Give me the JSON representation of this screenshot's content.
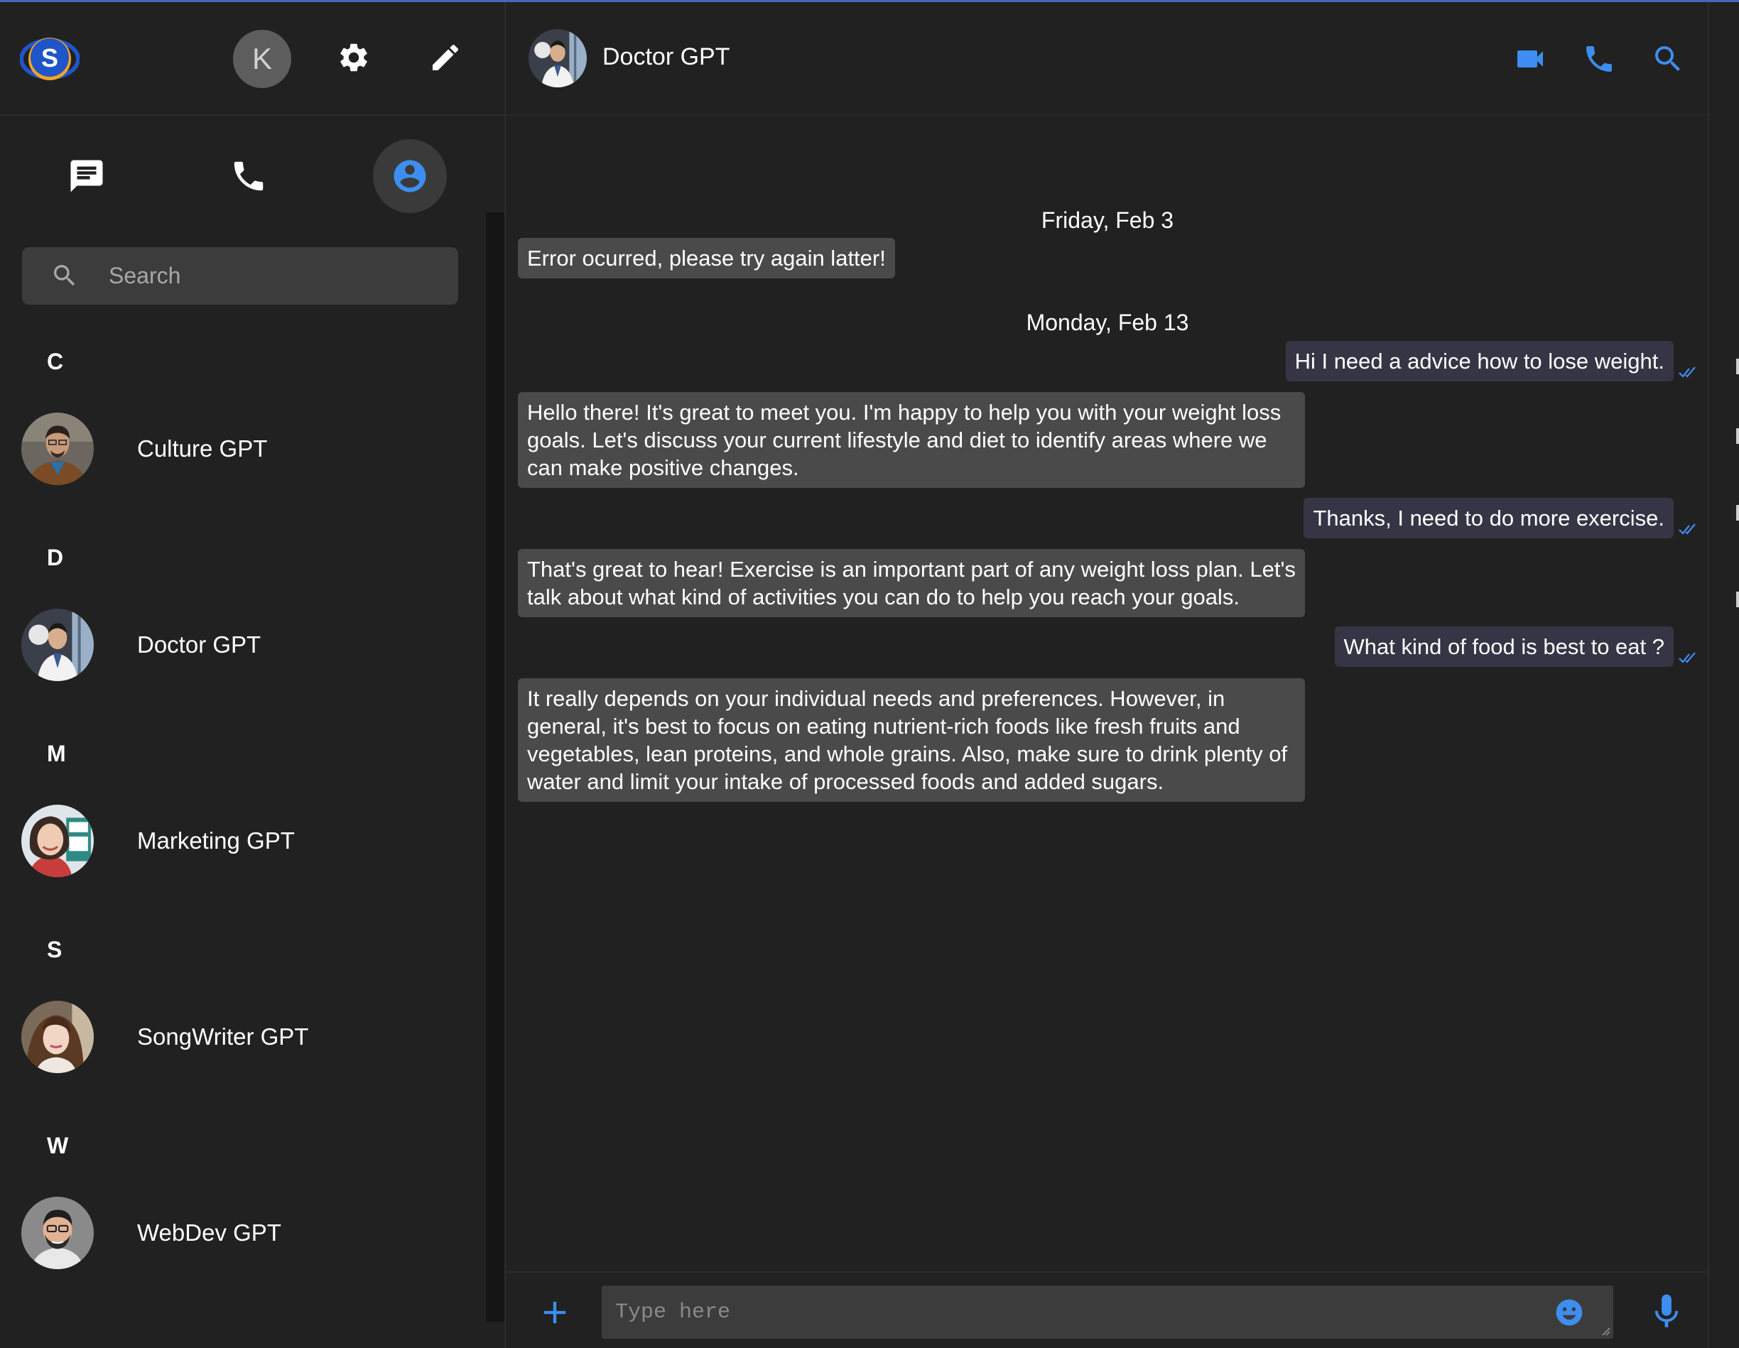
{
  "sidebar": {
    "logo_letter": "S",
    "user_initial": "K",
    "search_placeholder": "Search",
    "groups": [
      {
        "letter": "C",
        "contact": "Culture GPT"
      },
      {
        "letter": "D",
        "contact": "Doctor GPT"
      },
      {
        "letter": "M",
        "contact": "Marketing GPT"
      },
      {
        "letter": "S",
        "contact": "SongWriter GPT"
      },
      {
        "letter": "W",
        "contact": "WebDev GPT"
      }
    ]
  },
  "chat": {
    "title": "Doctor GPT",
    "dates": [
      "Friday, Feb 3",
      "Monday, Feb 13"
    ],
    "messages": [
      {
        "dir": "in",
        "text": "Error ocurred, please try again latter!"
      },
      {
        "dir": "out",
        "text": "Hi I need a advice how to lose weight."
      },
      {
        "dir": "in",
        "text": "Hello there! It's great to meet you. I'm happy to help you with your weight loss goals. Let's discuss your current lifestyle and diet to identify areas where we can make positive changes."
      },
      {
        "dir": "out",
        "text": "Thanks, I need to do more exercise."
      },
      {
        "dir": "in",
        "text": "That's great to hear! Exercise is an important part of any weight loss plan. Let's talk about what kind of activities you can do to help you reach your goals."
      },
      {
        "dir": "out",
        "text": "What kind of food is best to eat ?"
      },
      {
        "dir": "in",
        "text": "It really depends on your individual needs and preferences. However, in general, it's best to focus on eating nutrient-rich foods like fresh fruits and vegetables, lean proteins, and whole grains. Also, make sure to drink plenty of water and limit your intake of processed foods and added sugars."
      }
    ],
    "composer_placeholder": "Type here"
  },
  "icons": {
    "settings": "gear-icon",
    "compose": "pencil-icon",
    "chats_tab": "chat-bubble-icon",
    "calls_tab": "phone-icon",
    "contacts_tab": "account-circle-icon",
    "search": "search-icon",
    "video": "video-camera-icon",
    "voice": "phone-icon",
    "attach": "plus-icon",
    "emoji": "emoji-icon",
    "mic": "microphone-icon",
    "read_receipt": "double-check-icon"
  },
  "colors": {
    "accent": "#3d8ef0",
    "background": "#212121",
    "incoming_bubble": "#4a4a4a",
    "outgoing_bubble": "#353545",
    "logo_blue": "#1f55c8",
    "logo_orange": "#f4a526"
  }
}
